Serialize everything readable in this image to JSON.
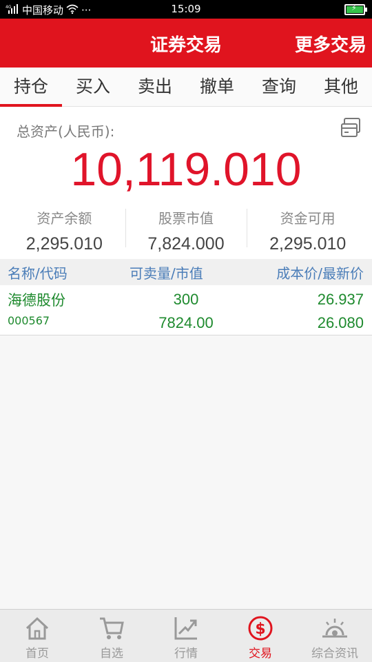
{
  "status_bar": {
    "carrier": "中国移动",
    "signal": "4G",
    "dots": "···",
    "time": "15:09"
  },
  "header": {
    "title": "证券交易",
    "more": "更多交易"
  },
  "tabs": [
    {
      "label": "持仓",
      "active": true
    },
    {
      "label": "买入"
    },
    {
      "label": "卖出"
    },
    {
      "label": "撤单"
    },
    {
      "label": "查询"
    },
    {
      "label": "其他"
    }
  ],
  "assets": {
    "total_label": "总资产(人民币):",
    "total_value": "10,119.010",
    "balance_label": "资产余额",
    "balance_value": "2,295.010",
    "market_label": "股票市值",
    "market_value": "7,824.000",
    "available_label": "资金可用",
    "available_value": "2,295.010"
  },
  "table": {
    "headers": [
      "名称/代码",
      "可卖量/市值",
      "成本价/最新价"
    ],
    "rows": [
      {
        "name": "海德股份",
        "code": "000567",
        "qty": "300",
        "value": "7824.00",
        "cost": "26.937",
        "latest": "26.080"
      }
    ]
  },
  "bottom_nav": [
    {
      "label": "首页",
      "icon": "home-icon"
    },
    {
      "label": "自选",
      "icon": "cart-icon"
    },
    {
      "label": "行情",
      "icon": "chart-trend-icon"
    },
    {
      "label": "交易",
      "icon": "dollar-circle-icon",
      "active": true
    },
    {
      "label": "综合资讯",
      "icon": "sunrise-icon"
    }
  ],
  "colors": {
    "brand_red": "#e0141e",
    "gain_green": "#1e8a2e",
    "header_blue": "#4a7db8"
  }
}
